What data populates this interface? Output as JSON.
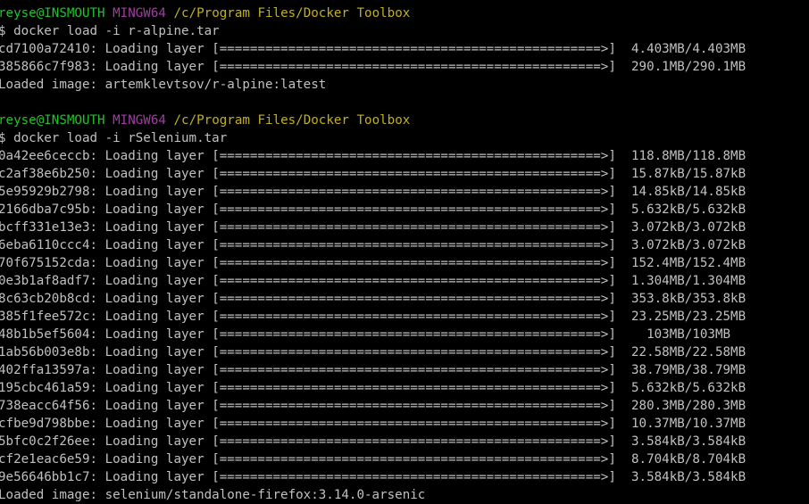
{
  "terminal": {
    "sessions": [
      {
        "prompt": {
          "user_host": "reyse@INSMOUTH",
          "shell": "MINGW64",
          "path": "/c/Program Files/Docker Toolbox"
        },
        "command": "$ docker load -i r-alpine.tar",
        "layers": [
          {
            "id": "cd7100a72410",
            "status": "Loading layer",
            "bar": "[==================================================>]",
            "size": "4.403MB/4.403MB"
          },
          {
            "id": "385866c7f983",
            "status": "Loading layer",
            "bar": "[==================================================>]",
            "size": "290.1MB/290.1MB"
          }
        ],
        "result": "Loaded image: artemklevtsov/r-alpine:latest"
      },
      {
        "prompt": {
          "user_host": "reyse@INSMOUTH",
          "shell": "MINGW64",
          "path": "/c/Program Files/Docker Toolbox"
        },
        "command": "$ docker load -i rSelenium.tar",
        "layers": [
          {
            "id": "0a42ee6ceccb",
            "status": "Loading layer",
            "bar": "[==================================================>]",
            "size": "118.8MB/118.8MB"
          },
          {
            "id": "c2af38e6b250",
            "status": "Loading layer",
            "bar": "[==================================================>]",
            "size": "15.87kB/15.87kB"
          },
          {
            "id": "5e95929b2798",
            "status": "Loading layer",
            "bar": "[==================================================>]",
            "size": "14.85kB/14.85kB"
          },
          {
            "id": "2166dba7c95b",
            "status": "Loading layer",
            "bar": "[==================================================>]",
            "size": "5.632kB/5.632kB"
          },
          {
            "id": "bcff331e13e3",
            "status": "Loading layer",
            "bar": "[==================================================>]",
            "size": "3.072kB/3.072kB"
          },
          {
            "id": "6eba6110ccc4",
            "status": "Loading layer",
            "bar": "[==================================================>]",
            "size": "3.072kB/3.072kB"
          },
          {
            "id": "70f675152cda",
            "status": "Loading layer",
            "bar": "[==================================================>]",
            "size": "152.4MB/152.4MB"
          },
          {
            "id": "0e3b1af8adf7",
            "status": "Loading layer",
            "bar": "[==================================================>]",
            "size": "1.304MB/1.304MB"
          },
          {
            "id": "8c63cb20b8cd",
            "status": "Loading layer",
            "bar": "[==================================================>]",
            "size": "353.8kB/353.8kB"
          },
          {
            "id": "385f1fee572c",
            "status": "Loading layer",
            "bar": "[==================================================>]",
            "size": "23.25MB/23.25MB"
          },
          {
            "id": "48b1b5ef5604",
            "status": "Loading layer",
            "bar": "[==================================================>]",
            "size": "  103MB/103MB"
          },
          {
            "id": "1ab56b003e8b",
            "status": "Loading layer",
            "bar": "[==================================================>]",
            "size": "22.58MB/22.58MB"
          },
          {
            "id": "402ffa13597a",
            "status": "Loading layer",
            "bar": "[==================================================>]",
            "size": "38.79MB/38.79MB"
          },
          {
            "id": "195cbc461a59",
            "status": "Loading layer",
            "bar": "[==================================================>]",
            "size": "5.632kB/5.632kB"
          },
          {
            "id": "738eacc64f56",
            "status": "Loading layer",
            "bar": "[==================================================>]",
            "size": "280.3MB/280.3MB"
          },
          {
            "id": "cfbe9d798bbe",
            "status": "Loading layer",
            "bar": "[==================================================>]",
            "size": "10.37MB/10.37MB"
          },
          {
            "id": "5bfc0c2f26ee",
            "status": "Loading layer",
            "bar": "[==================================================>]",
            "size": "3.584kB/3.584kB"
          },
          {
            "id": "cf2e1eac6e59",
            "status": "Loading layer",
            "bar": "[==================================================>]",
            "size": "8.704kB/8.704kB"
          },
          {
            "id": "9e56646bb1c7",
            "status": "Loading layer",
            "bar": "[==================================================>]",
            "size": "3.584kB/3.584kB"
          }
        ],
        "result": "Loaded image: selenium/standalone-firefox:3.14.0-arsenic"
      }
    ],
    "colors": {
      "background": "#000000",
      "text": "#c0c0c0",
      "user_host": "#1fc32a",
      "shell": "#a23ba6",
      "path": "#c1b01e"
    }
  }
}
